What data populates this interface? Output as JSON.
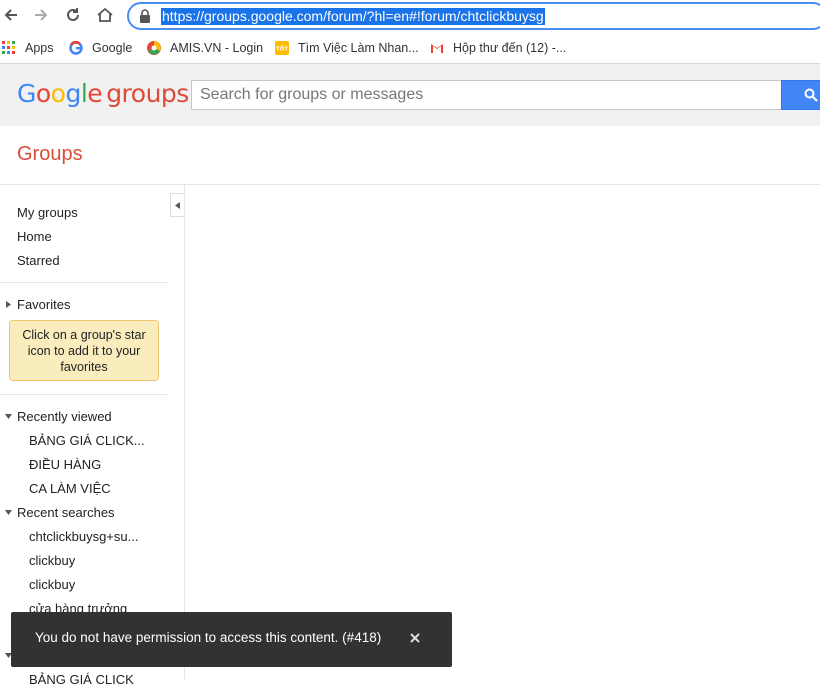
{
  "browser": {
    "url": "https://groups.google.com/forum/?hl=en#!forum/chtclickbuysg",
    "bookmarks": [
      {
        "label": "Apps",
        "icon": "apps-grid-icon"
      },
      {
        "label": "Google",
        "icon": "google-g-icon"
      },
      {
        "label": "AMIS.VN - Login",
        "icon": "amis-icon"
      },
      {
        "label": "Tìm Việc Làm Nhan...",
        "icon": "tot-icon"
      },
      {
        "label": "Hộp thư đến (12) -...",
        "icon": "gmail-icon"
      }
    ]
  },
  "header": {
    "logo_google": "Google",
    "logo_groups": "groups",
    "search_placeholder": "Search for groups or messages"
  },
  "page": {
    "title": "Groups"
  },
  "sidebar": {
    "nav": [
      "My groups",
      "Home",
      "Starred"
    ],
    "favorites": {
      "label": "Favorites",
      "hint": "Click on a group's star icon to add it to your favorites"
    },
    "recently_viewed": {
      "label": "Recently viewed",
      "items": [
        "BẢNG GIÁ CLICK...",
        "ĐIỀU HÀNG",
        "CA LÀM VIỆC"
      ]
    },
    "recent_searches": {
      "label": "Recent searches",
      "items": [
        "chtclickbuysg+su...",
        "clickbuy",
        "clickbuy",
        "cửa hàng trưởng"
      ]
    },
    "partial_item": "BẢNG GIÁ CLICK"
  },
  "toast": {
    "message": "You do not have permission to access this content. (#418)"
  },
  "colors": {
    "accent": "#4285f4",
    "brand_red": "#dd4b39",
    "toast_bg": "#323232",
    "hint_bg": "#f9edbe"
  }
}
